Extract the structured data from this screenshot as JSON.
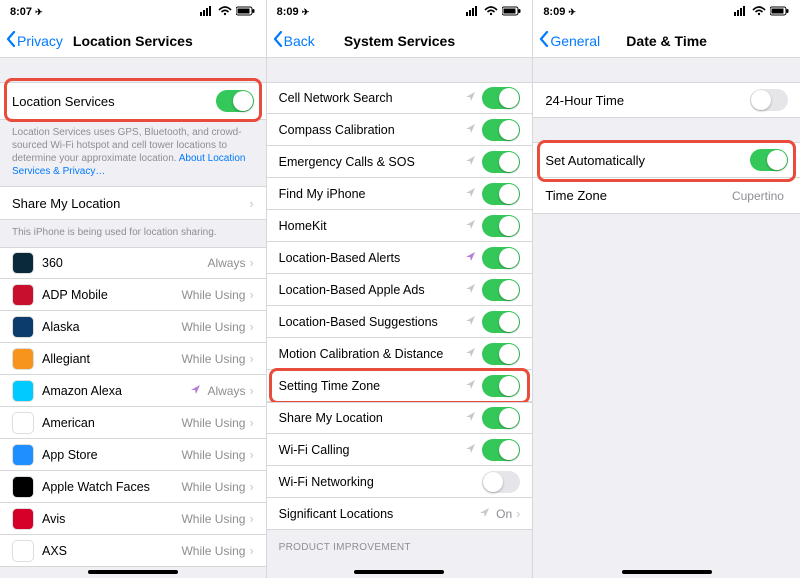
{
  "screen1": {
    "status": {
      "time": "8:07",
      "nav_glyph": "➤"
    },
    "nav": {
      "back": "Privacy",
      "title": "Location Services"
    },
    "loc_services_label": "Location Services",
    "loc_services_on": true,
    "footer_text_a": "Location Services uses GPS, Bluetooth, and crowd-sourced Wi-Fi hotspot and cell tower locations to determine your approximate location. ",
    "footer_link": "About Location Services & Privacy…",
    "share_label": "Share My Location",
    "share_footer": "This iPhone is being used for location sharing.",
    "apps": [
      {
        "name": "360",
        "status": "Always",
        "bg": "#0a2a3a"
      },
      {
        "name": "ADP Mobile",
        "status": "While Using",
        "bg": "#c8102e"
      },
      {
        "name": "Alaska",
        "status": "While Using",
        "bg": "#0b3c6b"
      },
      {
        "name": "Allegiant",
        "status": "While Using",
        "bg": "#f7941e"
      },
      {
        "name": "Amazon Alexa",
        "status": "Always",
        "bg": "#00caff",
        "purple": true
      },
      {
        "name": "American",
        "status": "While Using",
        "bg": "#ffffff"
      },
      {
        "name": "App Store",
        "status": "While Using",
        "bg": "#1f8fff"
      },
      {
        "name": "Apple Watch Faces",
        "status": "While Using",
        "bg": "#000000"
      },
      {
        "name": "Avis",
        "status": "While Using",
        "bg": "#d4002a"
      },
      {
        "name": "AXS",
        "status": "While Using",
        "bg": "#ffffff"
      }
    ]
  },
  "screen2": {
    "status": {
      "time": "8:09",
      "nav_glyph": "➤"
    },
    "nav": {
      "back": "Back",
      "title": "System Services"
    },
    "items": [
      {
        "name": "Cell Network Search",
        "on": true,
        "arrow": true
      },
      {
        "name": "Compass Calibration",
        "on": true,
        "arrow": true
      },
      {
        "name": "Emergency Calls & SOS",
        "on": true,
        "arrow": true
      },
      {
        "name": "Find My iPhone",
        "on": true,
        "arrow": true
      },
      {
        "name": "HomeKit",
        "on": true,
        "arrow": true
      },
      {
        "name": "Location-Based Alerts",
        "on": true,
        "arrow": true,
        "purple": true
      },
      {
        "name": "Location-Based Apple Ads",
        "on": true,
        "arrow": true
      },
      {
        "name": "Location-Based Suggestions",
        "on": true,
        "arrow": true
      },
      {
        "name": "Motion Calibration & Distance",
        "on": true,
        "arrow": true
      },
      {
        "name": "Setting Time Zone",
        "on": true,
        "arrow": true,
        "hilite": true
      },
      {
        "name": "Share My Location",
        "on": true,
        "arrow": true
      },
      {
        "name": "Wi-Fi Calling",
        "on": true,
        "arrow": true
      },
      {
        "name": "Wi-Fi Networking",
        "on": false,
        "arrow": false
      },
      {
        "name": "Significant Locations",
        "value": "On",
        "disclosure": true,
        "arrow": true
      }
    ],
    "section2_header": "PRODUCT IMPROVEMENT"
  },
  "screen3": {
    "status": {
      "time": "8:09",
      "nav_glyph": "➤"
    },
    "nav": {
      "back": "General",
      "title": "Date & Time"
    },
    "row24h": {
      "label": "24-Hour Time",
      "on": false
    },
    "row_auto": {
      "label": "Set Automatically",
      "on": true
    },
    "row_tz": {
      "label": "Time Zone",
      "value": "Cupertino"
    }
  }
}
